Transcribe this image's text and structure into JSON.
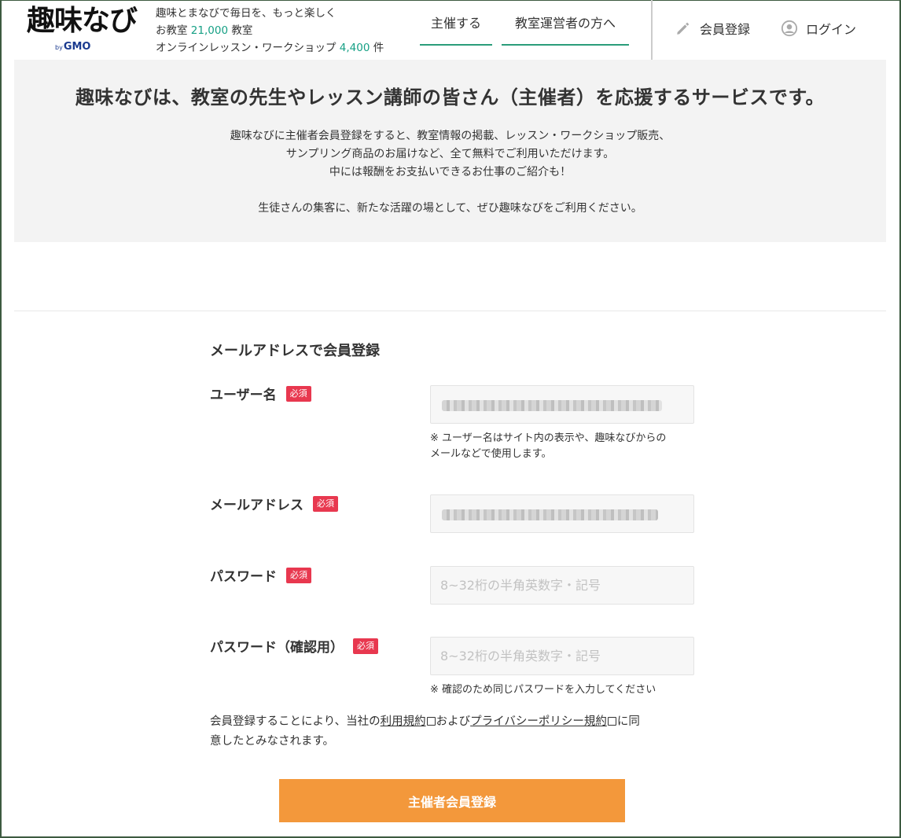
{
  "header": {
    "logo_text": "趣味なび",
    "logo_by": "by",
    "logo_brand": "GMO",
    "tagline_line1": "趣味とまなびで毎日を、もっと楽しく",
    "tagline_line2_prefix": "お教室",
    "tagline_classroom_count": "21,000",
    "tagline_line2_suffix": "教室",
    "tagline_line3_prefix": "オンラインレッスン・ワークショップ",
    "tagline_lesson_count": "4,400",
    "tagline_line3_suffix": "件",
    "nav_host": "主催する",
    "nav_operators": "教室運営者の方へ",
    "register": "会員登録",
    "login": "ログイン"
  },
  "intro": {
    "heading": "趣味なびは、教室の先生やレッスン講師の皆さん（主催者）を応援するサービスです。",
    "line1": "趣味なびに主催者会員登録をすると、教室情報の掲載、レッスン・ワークショップ販売、",
    "line2": "サンプリング商品のお届けなど、全て無料でご利用いただけます。",
    "line3": "中には報酬をお支払いできるお仕事のご紹介も！",
    "line4": "生徒さんの集客に、新たな活躍の場として、ぜひ趣味なびをご利用ください。"
  },
  "form": {
    "title": "メールアドレスで会員登録",
    "required_badge": "必須",
    "username_label": "ユーザー名",
    "username_note_line1": "※ ユーザー名はサイト内の表示や、趣味なびからの",
    "username_note_line2": "メールなどで使用します。",
    "email_label": "メールアドレス",
    "password_label": "パスワード",
    "password_placeholder": "8~32桁の半角英数字・記号",
    "password_confirm_label": "パスワード（確認用）",
    "password_confirm_placeholder": "8~32桁の半角英数字・記号",
    "password_confirm_note": "※ 確認のため同じパスワードを入力してください",
    "terms_prefix": "会員登録することにより、当社の",
    "terms_link": "利用規約",
    "terms_middle": "および",
    "privacy_link": "プライバシーポリシー規約",
    "terms_suffix_line1": "に同",
    "terms_suffix_line2": "意したとみなされます。",
    "submit": "主催者会員登録"
  },
  "colors": {
    "accent_green": "#2a9d7a",
    "required_red": "#e8384f",
    "submit_orange": "#f3983b"
  }
}
